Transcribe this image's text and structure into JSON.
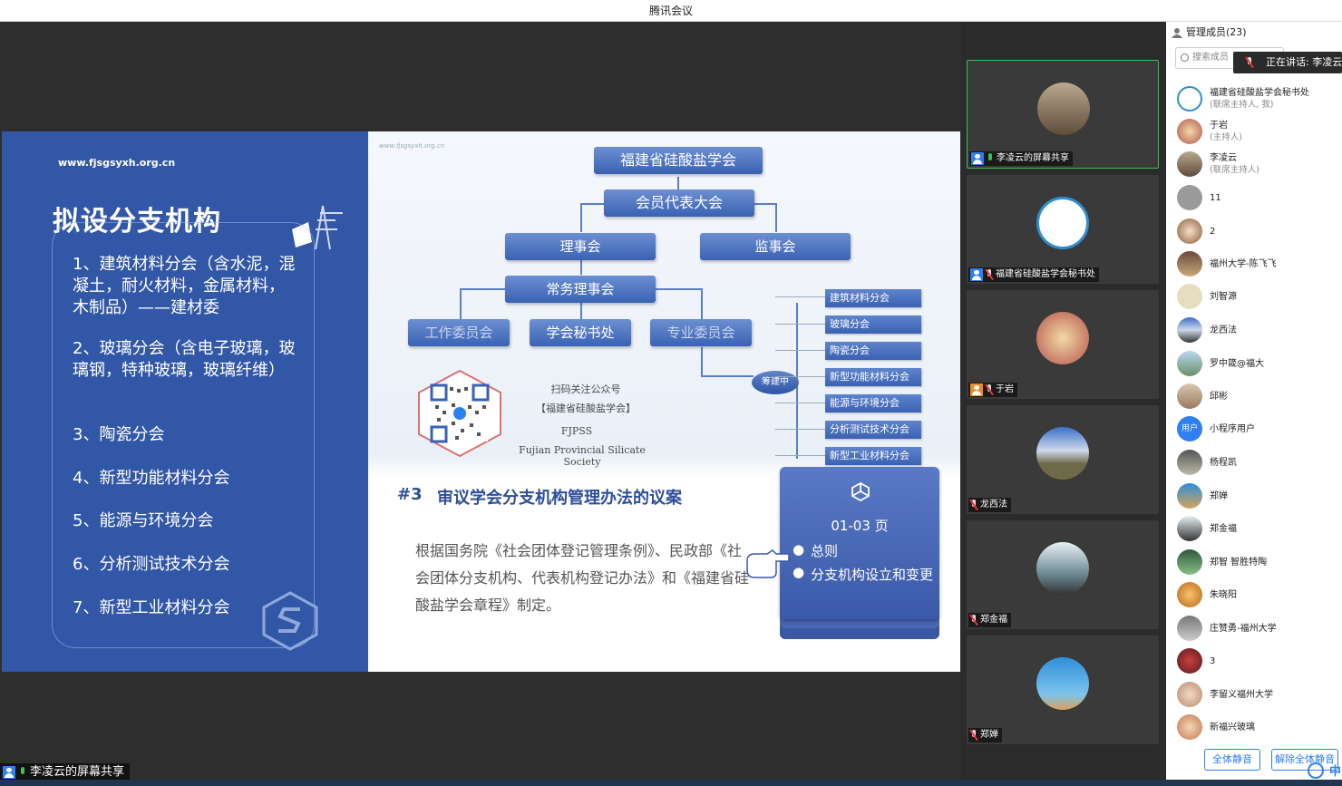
{
  "window": {
    "title": "腾讯会议"
  },
  "slide": {
    "url": "www.fjsgsyxh.org.cn",
    "title": "拟设分支机构",
    "branches": [
      "1、建筑材料分会（含水泥，混凝土，耐火材料，金属材料，木制品）——建材委",
      "2、玻璃分会（含电子玻璃，玻璃钢，特种玻璃，玻璃纤维）",
      "3、陶瓷分会",
      "4、新型功能材料分会",
      "5、能源与环境分会",
      "6、分析测试技术分会",
      "7、新型工业材料分会"
    ],
    "watermark": "www.fjsgsyxh.org.cn",
    "org": {
      "root": "福建省硅酸盐学会",
      "congress": "会员代表大会",
      "council": "理事会",
      "supervisors": "监事会",
      "standing": "常务理事会",
      "work": "工作委员会",
      "secretariat": "学会秘书处",
      "special": "专业委员会",
      "preparing": "筹建中",
      "subs": [
        "建筑材料分会",
        "玻璃分会",
        "陶瓷分会",
        "新型功能材料分会",
        "能源与环境分会",
        "分析测试技术分会",
        "新型工业材料分会"
      ]
    },
    "qr": {
      "line1": "扫码关注公众号",
      "line2": "【福建省硅酸盐学会】",
      "line3": "FJPSS",
      "line4": "Fujian Provincial Silicate Society"
    },
    "agenda_no": "#3",
    "agenda_title": "审议学会分支机构管理办法的议案",
    "body": "根据国务院《社会团体登记管理条例》、民政部《社会团体分支机构、代表机构登记办法》和《福建省硅酸盐学会章程》制定。",
    "card": {
      "pages": "01-03 页",
      "items": [
        "总则",
        "分支机构设立和变更"
      ]
    }
  },
  "participants": [
    {
      "label": "李凌云的屏幕共享",
      "active": true
    },
    {
      "label": "福建省硅酸盐学会秘书处",
      "active": false
    },
    {
      "label": "于岩",
      "active": false
    },
    {
      "label": "龙西法",
      "active": false
    },
    {
      "label": "郑金福",
      "active": false
    },
    {
      "label": "郑婵",
      "active": false
    }
  ],
  "panel": {
    "header": "管理成员(23)",
    "search_placeholder": "搜索成员",
    "speaking": "正在讲话: 李凌云;",
    "members": [
      {
        "name": "福建省硅酸盐学会秘书处",
        "role": "(联席主持人, 我)"
      },
      {
        "name": "于岩",
        "role": "(主持人)"
      },
      {
        "name": "李凌云",
        "role": "(联席主持人)"
      },
      {
        "name": "11",
        "role": ""
      },
      {
        "name": "2",
        "role": ""
      },
      {
        "name": "福州大学-陈飞飞",
        "role": ""
      },
      {
        "name": "刘智源",
        "role": ""
      },
      {
        "name": "龙西法",
        "role": ""
      },
      {
        "name": "罗中箴@福大",
        "role": ""
      },
      {
        "name": "邱彬",
        "role": ""
      },
      {
        "name": "小程序用户",
        "role": ""
      },
      {
        "name": "杨程凯",
        "role": ""
      },
      {
        "name": "郑婵",
        "role": ""
      },
      {
        "name": "郑金福",
        "role": ""
      },
      {
        "name": "郑智 智胜特陶",
        "role": ""
      },
      {
        "name": "朱晓阳",
        "role": ""
      },
      {
        "name": "庄赞勇-福州大学",
        "role": ""
      },
      {
        "name": "3",
        "role": ""
      },
      {
        "name": "李留义福州大学",
        "role": ""
      },
      {
        "name": "新福兴玻璃",
        "role": ""
      }
    ],
    "user_avatar_text": "用户",
    "mute_all": "全体静音",
    "unmute_all": "解除全体静音",
    "corner_text": "中"
  },
  "share_bar": {
    "label": "李凌云的屏幕共享"
  },
  "colors": {
    "slide_blue": "#3257a7",
    "accent": "#2e7ff0",
    "active_border": "#3dbd5b"
  }
}
